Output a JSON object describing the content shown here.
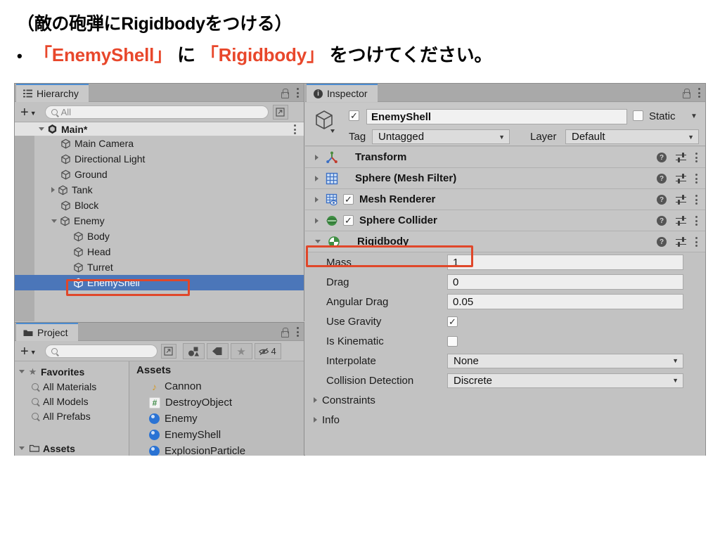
{
  "slide": {
    "title": "（敵の砲弾にRigidbodyをつける）",
    "bullet_dot": "•",
    "bullet_part1": "「EnemyShell」",
    "bullet_part2": " に ",
    "bullet_part3": "「Rigidbody」",
    "bullet_part4": " をつけてください。",
    "highlight_color": "#e8472b"
  },
  "hierarchy": {
    "tab_label": "Hierarchy",
    "tab_icon": "hierarchy-list-icon",
    "lock_icon": "lock-icon",
    "menu_icon": "kebab-menu-icon",
    "add_label": "+",
    "search_value": "",
    "search_placeholder": "All",
    "tree": [
      {
        "label": "Main*",
        "depth": 0,
        "arrow": "open",
        "icon": "unity-logo-icon",
        "bold": true,
        "selected": false
      },
      {
        "label": "Main Camera",
        "depth": 1,
        "arrow": "none",
        "icon": "cube-icon",
        "bold": false,
        "selected": false
      },
      {
        "label": "Directional Light",
        "depth": 1,
        "arrow": "none",
        "icon": "cube-icon",
        "bold": false,
        "selected": false
      },
      {
        "label": "Ground",
        "depth": 1,
        "arrow": "none",
        "icon": "cube-icon",
        "bold": false,
        "selected": false
      },
      {
        "label": "Tank",
        "depth": 1,
        "arrow": "closed",
        "icon": "cube-icon",
        "bold": false,
        "selected": false
      },
      {
        "label": "Block",
        "depth": 1,
        "arrow": "none",
        "icon": "cube-icon",
        "bold": false,
        "selected": false
      },
      {
        "label": "Enemy",
        "depth": 1,
        "arrow": "open",
        "icon": "cube-icon",
        "bold": false,
        "selected": false
      },
      {
        "label": "Body",
        "depth": 2,
        "arrow": "none",
        "icon": "cube-icon",
        "bold": false,
        "selected": false
      },
      {
        "label": "Head",
        "depth": 2,
        "arrow": "none",
        "icon": "cube-icon",
        "bold": false,
        "selected": false
      },
      {
        "label": "Turret",
        "depth": 2,
        "arrow": "none",
        "icon": "cube-icon",
        "bold": false,
        "selected": false
      },
      {
        "label": "EnemyShell",
        "depth": 2,
        "arrow": "none",
        "icon": "cube-icon",
        "bold": false,
        "selected": true
      }
    ]
  },
  "project": {
    "tab_label": "Project",
    "tab_icon": "folder-icon",
    "add_label": "+",
    "search_value": "",
    "search_placeholder": "",
    "toolbar_buttons": [
      {
        "name": "asset-filter-icon",
        "glyph": ""
      },
      {
        "name": "label-tag-icon",
        "glyph": ""
      },
      {
        "name": "favorite-star-icon",
        "glyph": "★"
      },
      {
        "name": "hidden-packages-icon",
        "glyph": "",
        "badge": "4"
      }
    ],
    "favorites_label": "Favorites",
    "favorites": [
      {
        "label": "All Materials"
      },
      {
        "label": "All Models"
      },
      {
        "label": "All Prefabs"
      }
    ],
    "assets_tree_label": "Assets",
    "assets_header": "Assets",
    "assets": [
      {
        "label": "Cannon",
        "icon": "audio-clip-icon"
      },
      {
        "label": "DestroyObject",
        "icon": "csharp-script-icon"
      },
      {
        "label": "Enemy",
        "icon": "prefab-icon"
      },
      {
        "label": "EnemyShell",
        "icon": "prefab-icon"
      },
      {
        "label": "ExplosionParticle",
        "icon": "prefab-icon"
      }
    ]
  },
  "inspector": {
    "tab_label": "Inspector",
    "tab_icon": "info-circle-icon",
    "enabled_checked": true,
    "object_name": "EnemyShell",
    "static_label": "Static",
    "static_checked": false,
    "tag_label": "Tag",
    "tag_value": "Untagged",
    "layer_label": "Layer",
    "layer_value": "Default",
    "components": [
      {
        "name": "Transform",
        "icon": "transform-axis-icon",
        "expanded": false,
        "has_toggle": false,
        "toggle_checked": false,
        "highlighted": false
      },
      {
        "name": "Sphere (Mesh Filter)",
        "icon": "mesh-filter-icon",
        "expanded": false,
        "has_toggle": false,
        "toggle_checked": false,
        "highlighted": false
      },
      {
        "name": "Mesh Renderer",
        "icon": "mesh-renderer-icon",
        "expanded": false,
        "has_toggle": true,
        "toggle_checked": true,
        "highlighted": false
      },
      {
        "name": "Sphere Collider",
        "icon": "sphere-collider-icon",
        "expanded": false,
        "has_toggle": true,
        "toggle_checked": true,
        "highlighted": false
      },
      {
        "name": "Rigidbody",
        "icon": "rigidbody-icon",
        "expanded": true,
        "has_toggle": false,
        "toggle_checked": false,
        "highlighted": true
      }
    ],
    "rigidbody_properties": [
      {
        "label": "Mass",
        "type": "text",
        "value": "1"
      },
      {
        "label": "Drag",
        "type": "text",
        "value": "0"
      },
      {
        "label": "Angular Drag",
        "type": "text",
        "value": "0.05"
      },
      {
        "label": "Use Gravity",
        "type": "checkbox",
        "value": true
      },
      {
        "label": "Is Kinematic",
        "type": "checkbox",
        "value": false
      },
      {
        "label": "Interpolate",
        "type": "dropdown",
        "value": "None"
      },
      {
        "label": "Collision Detection",
        "type": "dropdown",
        "value": "Discrete"
      }
    ],
    "foldouts": [
      {
        "label": "Constraints"
      },
      {
        "label": "Info"
      }
    ]
  },
  "annotations": {
    "box_color": "#e0472a",
    "boxes": [
      "enemyshell-hierarchy-row",
      "rigidbody-component-row"
    ]
  }
}
